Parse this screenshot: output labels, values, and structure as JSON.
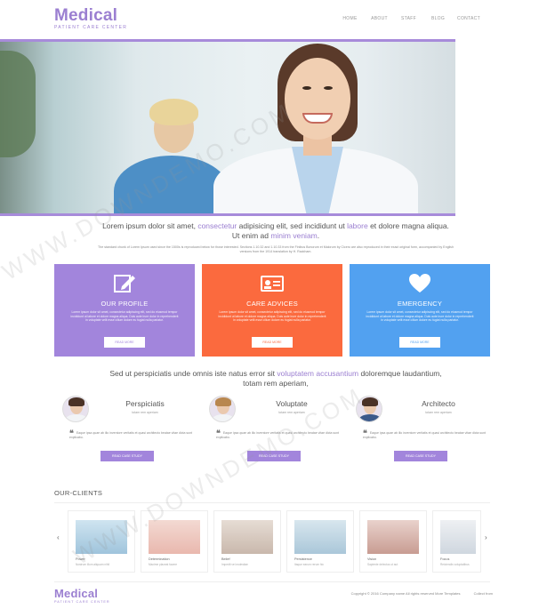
{
  "brand": {
    "name": "Medical",
    "tagline": "PATIENT CARE CENTER",
    "accent": "#9b7fd1"
  },
  "nav": [
    {
      "label": "HOME"
    },
    {
      "label": "ABOUT"
    },
    {
      "label": "STAFF"
    },
    {
      "label": "BLOG"
    },
    {
      "label": "CONTACT"
    }
  ],
  "intro": {
    "lead_1": "Lorem ipsum dolor sit amet, ",
    "lead_hl1": "consectetur",
    "lead_2": " adipisicing elit, sed incididunt ut ",
    "lead_hl2": "labore",
    "lead_3": " et dolore magna aliqua.",
    "lead_4": "Ut enim ad ",
    "lead_hl3": "minim veniam",
    "lead_5": ".",
    "small": "The standard chunk of Lorem Ipsum used since the 1500s is reproduced below for those interested. Sections 1.10.32 and 1.10.33 from the Finibus Bonorum et Malorum by Cicero are also reproduced in their exact original form, accompanied by English versions from the 1914 translation by H. Rackham."
  },
  "features": [
    {
      "title": "OUR PROFILE",
      "icon": "edit-icon",
      "color": "#a285dc",
      "text": "Lorem ipsum dolor sit amet, consectetur adipiscing elit, sed do eiusmod tempor incididunt ut labore et dolore magna aliqua. Duis aute irure dolor in reprehenderit in voluptate velit esse cillum dolore eu fugiat nulla pariatur.",
      "button": "READ MORE"
    },
    {
      "title": "CARE ADVICES",
      "icon": "id-card-icon",
      "color": "#fb6a3e",
      "text": "Lorem ipsum dolor sit amet, consectetur adipiscing elit, sed do eiusmod tempor incididunt ut labore et dolore magna aliqua. Duis aute irure dolor in reprehenderit in voluptate velit esse cillum dolore eu fugiat nulla pariatur.",
      "button": "READ MORE"
    },
    {
      "title": "EMERGENCY",
      "icon": "heart-icon",
      "color": "#52a1f0",
      "text": "Lorem ipsum dolor sit amet, consectetur adipiscing elit, sed do eiusmod tempor incididunt ut labore et dolore magna aliqua. Duis aute irure dolor in reprehenderit in voluptate velit esse cillum dolore eu fugiat nulla pariatur.",
      "button": "READ MORE"
    }
  ],
  "quote": {
    "q1": "Sed ut perspiciatis unde omnis iste natus error sit ",
    "qhl": "voluptatem accusantium",
    "q2": " doloremque laudantium,",
    "q3": "totam rem aperiam,"
  },
  "staff": [
    {
      "name": "Perspiciatis",
      "role": "totam rem aperiam",
      "text": "Eaque ipsa quae ab illo inventore veritatis et quasi architecto beatae vitae dicta sunt explicabo.",
      "button": "READ CASE STUDY"
    },
    {
      "name": "Voluptate",
      "role": "totam rem aperiam",
      "text": "Eaque ipsa quae ab illo inventore veritatis et quasi architecto beatae vitae dicta sunt explicabo.",
      "button": "READ CASE STUDY"
    },
    {
      "name": "Architecto",
      "role": "totam rem aperiam",
      "text": "Eaque ipsa quae ab illo inventore veritatis et quasi architecto beatae vitae dicta sunt explicabo.",
      "button": "READ CASE STUDY"
    }
  ],
  "clients": {
    "title": "OUR-CLIENTS",
    "items": [
      {
        "name": "Power",
        "desc": "Nostrum illum aliquam nihil"
      },
      {
        "name": "Determination",
        "desc": "Maxime placeat facere"
      },
      {
        "name": "Belief",
        "desc": "Impedit vel molestiae"
      },
      {
        "name": "Persistence",
        "desc": "Itaque earum rerum hic"
      },
      {
        "name": "Vision",
        "desc": "Sapiente delectus ut aut"
      },
      {
        "name": "Focus",
        "desc": "Reiciendis voluptatibus"
      }
    ],
    "prev": "‹",
    "next": "›"
  },
  "footer": {
    "copyright": "Copyright © 2016 Company name All rights reserved More Templates",
    "collect": "Collect from"
  },
  "watermark": "WWW.DOWNDEMO.COM"
}
